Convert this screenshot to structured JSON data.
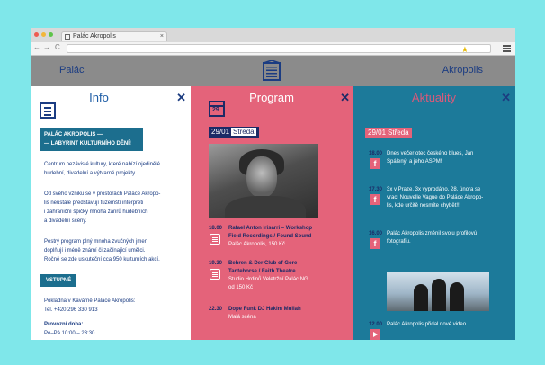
{
  "browser": {
    "tab_title": "Palác Akropolis",
    "tab_close": "×",
    "nav_back": "←",
    "nav_forward": "→",
    "nav_reload": "C",
    "star": "★"
  },
  "site": {
    "left_label": "Palác",
    "right_label": "Akropolis"
  },
  "info": {
    "title": "Info",
    "close": "✕",
    "headline_1": "PALÁC AKROPOLIS —",
    "headline_2": "— LABYRINT KULTURNÍHO DĚNÍ!",
    "p1": [
      "Centrum nezávislé kultury, které nabízí ojedinělé",
      "hudební, divadelní a výtvarné projekty."
    ],
    "p2": [
      "Od svého vzniku se v prostorách Paláce Akropo-",
      "lis neustále představují tuzemští interpreti",
      "i zahraniční špičky mnoha žánrů hudebních",
      "a divadelní scény."
    ],
    "p3": [
      "Pestrý program plný mnoha zvučných jmen",
      "doplňují i méně známí či začínající umělci.",
      "Ročně se zde uskuteční cca 950 kulturních akcí."
    ],
    "vstupne_label": "VSTUPNÉ",
    "p4": [
      "Pokladna v Kavárně Paláce Akropolis:",
      "Tel. +420 296 330 913"
    ],
    "hours_label": "Provozní doba:",
    "hours_value": "Po–Pá 10:00 – 23:30"
  },
  "program": {
    "title": "Program",
    "close": "✕",
    "calendar_number": "29",
    "date": "29/01",
    "day": "Středa",
    "events": [
      {
        "time": "18.00",
        "title": [
          "Rafael Anton Irisarri – Workshop",
          "Field Recordings / Found Sound"
        ],
        "venue": [
          "Palác Akropolis, 150 Kč"
        ]
      },
      {
        "time": "19.30",
        "title": [
          "Behren & Der Club of Gore",
          "Tantehorse / Faith Theatre"
        ],
        "venue": [
          "Studio Hrdinů Veletržní Palác NG",
          "od 150 Kč"
        ]
      },
      {
        "time": "22.30",
        "title": [
          "Dope Funk DJ Hakim Mullah"
        ],
        "venue": [
          "Malá scéna"
        ]
      }
    ]
  },
  "aktuality": {
    "title": "Aktuality",
    "close": "✕",
    "date": "29/01",
    "day": "Středa",
    "items": [
      {
        "time": "18.00",
        "icon": "f",
        "text": [
          "Dnes večer otec českého blues, Jan",
          "Spálený, a jeho ASPM!"
        ]
      },
      {
        "time": "17.30",
        "icon": "f",
        "text": [
          "3x v Praze, 3x vyprodáno. 28. února se",
          "vrací Nouvelle Vague do Paláce Akropo-",
          "lis, kde určitě nesmíte chybět!!!"
        ]
      },
      {
        "time": "16.00",
        "icon": "f",
        "text": [
          "Palác Akropolis změnil svoju profilovú",
          "fotografiu."
        ]
      },
      {
        "time": "12.00",
        "icon": "play",
        "text": [
          "Palác Akropolis přidal nové video."
        ]
      }
    ]
  },
  "colors": {
    "info_bg": "#ffffff",
    "program_bg": "#e4637a",
    "aktuality_bg": "#1c7a9a",
    "navy": "#1c2a66",
    "page_bg": "#7fe7ea"
  }
}
